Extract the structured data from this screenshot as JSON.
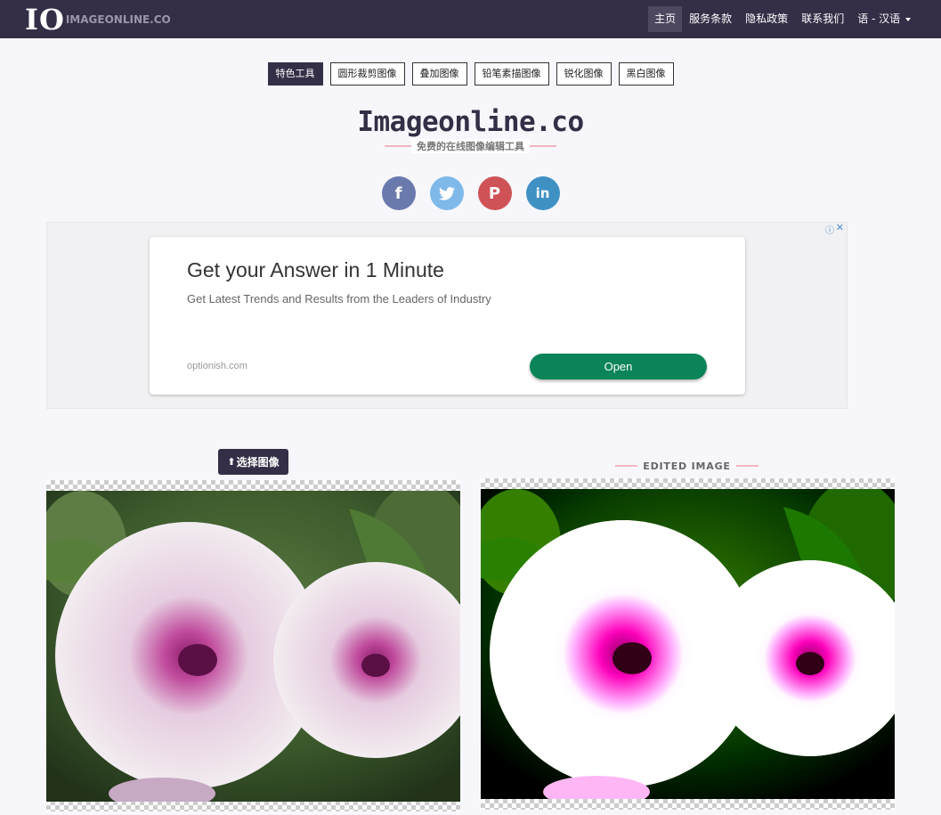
{
  "brand": {
    "logo_mark": "IO",
    "logo_text": "IMAGEONLINE.CO"
  },
  "nav": {
    "items": [
      {
        "label": "主页",
        "active": true
      },
      {
        "label": "服务条款"
      },
      {
        "label": "隐私政策"
      },
      {
        "label": "联系我们"
      },
      {
        "label": "语 - 汉语",
        "dropdown": true
      }
    ]
  },
  "tools": [
    {
      "label": "特色工具",
      "active": true
    },
    {
      "label": "圆形裁剪图像"
    },
    {
      "label": "叠加图像"
    },
    {
      "label": "铅笔素描图像"
    },
    {
      "label": "锐化图像"
    },
    {
      "label": "黑白图像"
    }
  ],
  "header": {
    "title": "Imageonline.co",
    "subtitle": "免费的在线图像编辑工具"
  },
  "social": [
    {
      "icon": "facebook-icon",
      "glyph": "f"
    },
    {
      "icon": "twitter-icon",
      "glyph": ""
    },
    {
      "icon": "pinterest-icon",
      "glyph": "P"
    },
    {
      "icon": "linkedin-icon",
      "glyph": "in"
    }
  ],
  "ad": {
    "title": "Get your Answer in 1 Minute",
    "description": "Get Latest Trends and Results from the Leaders of Industry",
    "domain": "optionish.com",
    "cta": "Open",
    "info_glyph": "ⓘ",
    "close_glyph": "✕"
  },
  "editor": {
    "upload_label": "选择图像",
    "upload_icon": "⬆",
    "edited_label": "EDITED IMAGE"
  },
  "colors": {
    "nav_bg": "#342e46",
    "accent_line": "#f2b6bf",
    "ad_button": "#0b8457"
  }
}
